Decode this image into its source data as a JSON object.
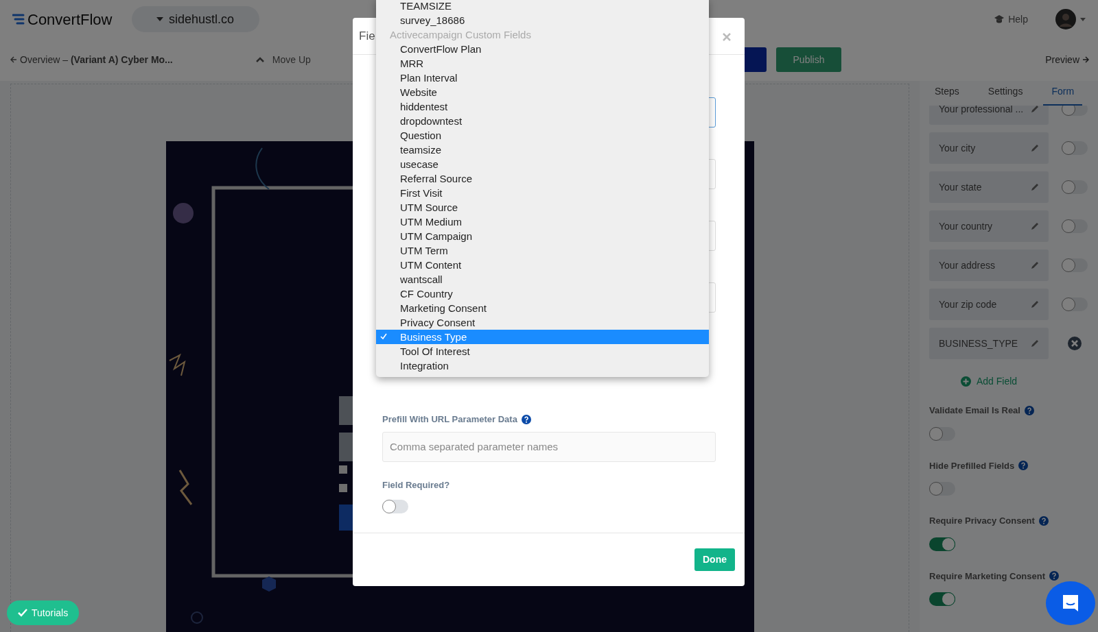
{
  "header": {
    "logo": "**Convert**Flow",
    "site": "sidehustl.co",
    "help": "Help"
  },
  "subbar": {
    "back": "Overview – **(Variant A) Cyber Mo...**",
    "move_up": "Move Up",
    "publish": "Publish",
    "preview": "Preview"
  },
  "sidebar": {
    "tabs": [
      {
        "label": "Steps",
        "selected": false
      },
      {
        "label": "Settings",
        "selected": false
      },
      {
        "label": "Form",
        "selected": true
      }
    ],
    "fields": [
      {
        "kind": "toggle",
        "label": "Your professional ...",
        "on": false
      },
      {
        "kind": "toggle",
        "label": "Your city",
        "on": false
      },
      {
        "kind": "toggle",
        "label": "Your state",
        "on": false
      },
      {
        "kind": "toggle",
        "label": "Your country",
        "on": false
      },
      {
        "kind": "toggle",
        "label": "Your address",
        "on": false
      },
      {
        "kind": "toggle",
        "label": "Your zip code",
        "on": false
      },
      {
        "kind": "removable",
        "label": "BUSINESS_TYPE"
      }
    ],
    "add_field": "Add Field",
    "settings": [
      {
        "label": "Validate Email Is Real",
        "on": false
      },
      {
        "label": "Hide Prefilled Fields",
        "on": false
      },
      {
        "label": "Require Privacy Consent",
        "on": true
      },
      {
        "label": "Require Marketing Consent",
        "on": true
      }
    ]
  },
  "modal": {
    "title": "Fie",
    "prefill_label": "Prefill With URL Parameter Data",
    "prefill_placeholder": "Comma separated parameter names",
    "required_label": "Field Required?",
    "required_on": false,
    "done": "Done"
  },
  "dropdown": {
    "items": [
      {
        "kind": "option",
        "label": "TEAMSIZE",
        "selected": false
      },
      {
        "kind": "option",
        "label": "survey_18686",
        "selected": false
      },
      {
        "kind": "group",
        "label": "Activecampaign Custom Fields",
        "selected": false
      },
      {
        "kind": "option",
        "label": "ConvertFlow Plan",
        "selected": false
      },
      {
        "kind": "option",
        "label": "MRR",
        "selected": false
      },
      {
        "kind": "option",
        "label": "Plan Interval",
        "selected": false
      },
      {
        "kind": "option",
        "label": "Website",
        "selected": false
      },
      {
        "kind": "option",
        "label": "hiddentest",
        "selected": false
      },
      {
        "kind": "option",
        "label": "dropdowntest",
        "selected": false
      },
      {
        "kind": "option",
        "label": "Question",
        "selected": false
      },
      {
        "kind": "option",
        "label": "teamsize",
        "selected": false
      },
      {
        "kind": "option",
        "label": "usecase",
        "selected": false
      },
      {
        "kind": "option",
        "label": "Referral Source",
        "selected": false
      },
      {
        "kind": "option",
        "label": "First Visit",
        "selected": false
      },
      {
        "kind": "option",
        "label": "UTM Source",
        "selected": false
      },
      {
        "kind": "option",
        "label": "UTM Medium",
        "selected": false
      },
      {
        "kind": "option",
        "label": "UTM Campaign",
        "selected": false
      },
      {
        "kind": "option",
        "label": "UTM Term",
        "selected": false
      },
      {
        "kind": "option",
        "label": "UTM Content",
        "selected": false
      },
      {
        "kind": "option",
        "label": "wantscall",
        "selected": false
      },
      {
        "kind": "option",
        "label": "CF Country",
        "selected": false
      },
      {
        "kind": "option",
        "label": "Marketing Consent",
        "selected": false
      },
      {
        "kind": "option",
        "label": "Privacy Consent",
        "selected": false
      },
      {
        "kind": "option",
        "label": "Business Type",
        "selected": true
      },
      {
        "kind": "option",
        "label": "Tool Of Interest",
        "selected": false
      },
      {
        "kind": "option",
        "label": "Integration",
        "selected": false
      }
    ]
  },
  "tutorials": "Tutorials"
}
